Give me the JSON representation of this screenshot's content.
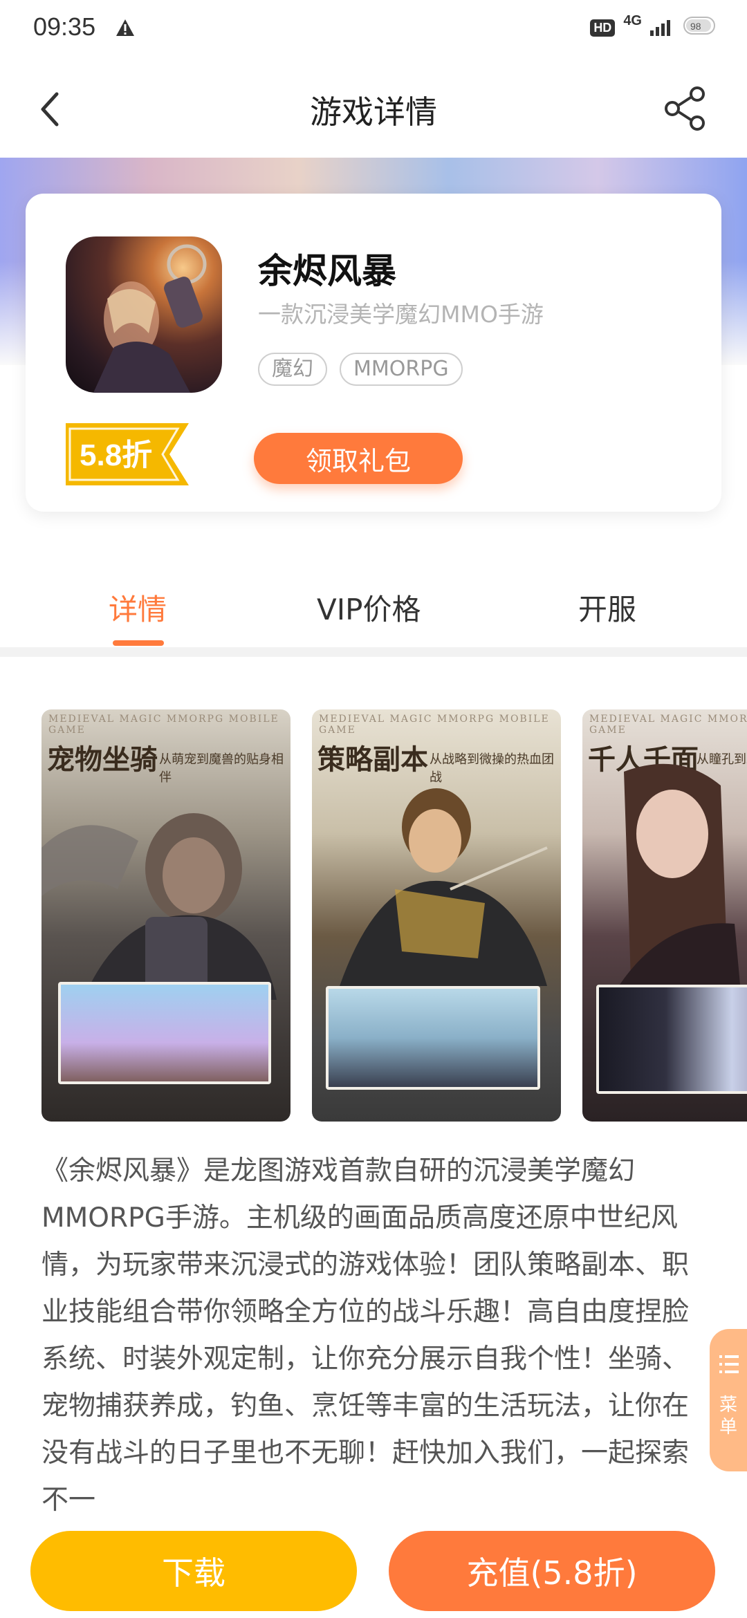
{
  "status": {
    "time": "09:35",
    "hd": "HD",
    "network": "4G",
    "battery": "98"
  },
  "nav": {
    "title": "游戏详情"
  },
  "game": {
    "name": "余烬风暴",
    "subtitle": "一款沉浸美学魔幻MMO手游",
    "tags": [
      "魔幻",
      "MMORPG"
    ],
    "discount": "5.8折",
    "gift_button": "领取礼包"
  },
  "tabs": [
    {
      "label": "详情",
      "active": true
    },
    {
      "label": "VIP价格",
      "active": false
    },
    {
      "label": "开服",
      "active": false
    }
  ],
  "screenshots": [
    {
      "top_text": "MEDIEVAL MAGIC MMORPG MOBILE GAME",
      "title": "宠物坐骑",
      "subtitle": "从萌宠到魔兽的贴身相伴"
    },
    {
      "top_text": "MEDIEVAL MAGIC MMORPG MOBILE GAME",
      "title": "策略副本",
      "subtitle": "从战略到微操的热血团战"
    },
    {
      "top_text": "MEDIEVAL MAGIC MMORPG MOBILE GAME",
      "title": "千人千面",
      "subtitle": "从瞳孔到发"
    }
  ],
  "description": "《余烬风暴》是龙图游戏首款自研的沉浸美学魔幻MMORPG手游。主机级的画面品质高度还原中世纪风情，为玩家带来沉浸式的游戏体验！团队策略副本、职业技能组合带你领略全方位的战斗乐趣！高自由度捏脸系统、时装外观定制，让你充分展示自我个性！坐骑、宠物捕获养成，钓鱼、烹饪等丰富的生活玩法，让你在没有战斗的日子里也不无聊！赶快加入我们，一起探索不一",
  "floating_menu": {
    "label": "菜单"
  },
  "bottom": {
    "download": "下载",
    "recharge": "充值(5.8折)"
  },
  "colors": {
    "accent": "#ff7a3c",
    "download": "#ffbc00",
    "discount": "#f5b800"
  }
}
